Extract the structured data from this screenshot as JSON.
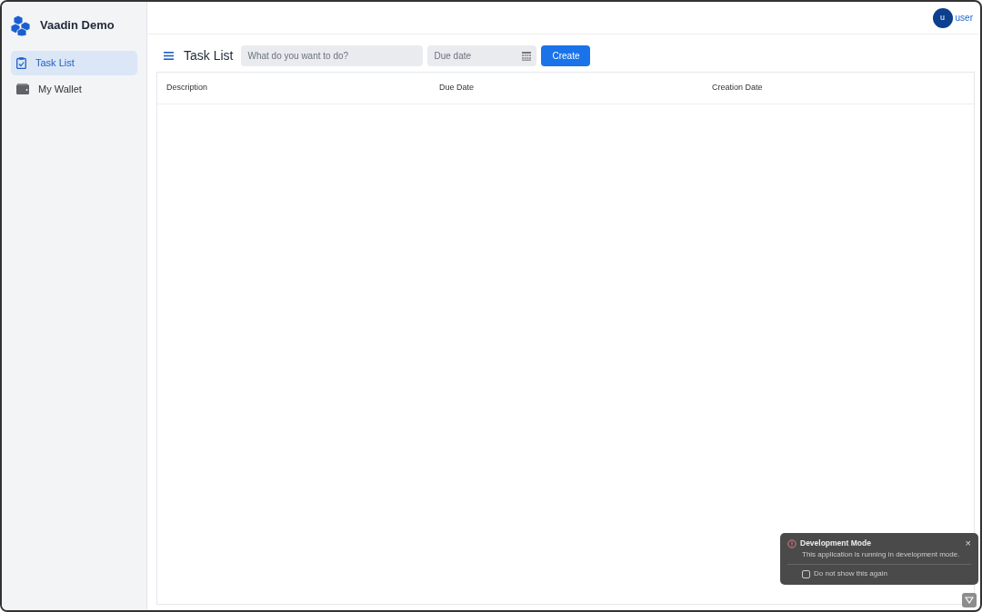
{
  "app": {
    "title": "Vaadin Demo"
  },
  "nav": [
    {
      "label": "Task List",
      "kind": "clipboard",
      "selected": true
    },
    {
      "label": "My Wallet",
      "kind": "wallet",
      "selected": false
    }
  ],
  "user": {
    "initial": "u",
    "name": "user"
  },
  "view": {
    "title": "Task List"
  },
  "form": {
    "description": {
      "placeholder": "What do you want to do?"
    },
    "due": {
      "placeholder": "Due date"
    },
    "button": "Create"
  },
  "grid": {
    "columns": [
      "Description",
      "Due Date",
      "Creation Date"
    ]
  },
  "notification": {
    "title": "Development Mode",
    "message": "This application is running in development mode.",
    "close": "×",
    "checkbox": {
      "label": "Do not show this again",
      "checked": false
    }
  }
}
